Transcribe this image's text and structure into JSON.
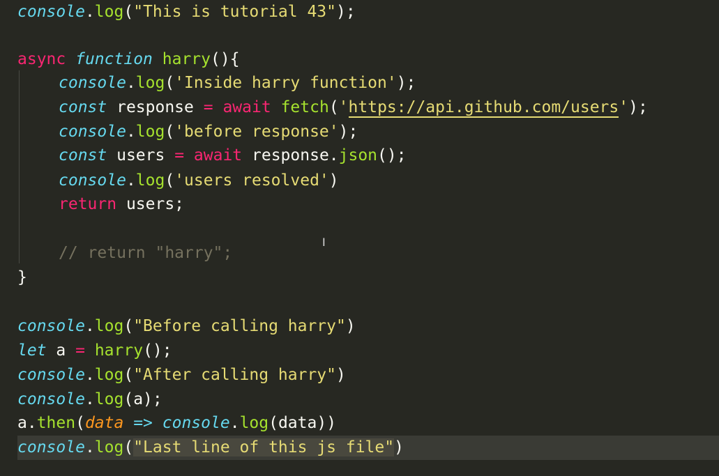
{
  "code": {
    "l1": {
      "obj": "console",
      "dot": ".",
      "fn": "log",
      "open": "(",
      "str": "\"This is tutorial 43\"",
      "close": ");"
    },
    "l3": {
      "kw": "async",
      "sp": " ",
      "kw2": "function",
      "sp2": " ",
      "name": "harry",
      "rest": "(){"
    },
    "l4": {
      "obj": "console",
      "dot": ".",
      "fn": "log",
      "open": "(",
      "str": "'Inside harry function'",
      "close": ");"
    },
    "l5": {
      "kw": "const",
      "v": " response ",
      "op": "=",
      "sp": " ",
      "aw": "await",
      "sp2": " ",
      "fn": "fetch",
      "open": "(",
      "q1": "'",
      "url": "https://api.github.com/users",
      "q2": "'",
      "close": ");"
    },
    "l6": {
      "obj": "console",
      "dot": ".",
      "fn": "log",
      "open": "(",
      "str": "'before response'",
      "close": ");"
    },
    "l7": {
      "kw": "const",
      "v": " users ",
      "op": "=",
      "sp": " ",
      "aw": "await",
      "sp2": " ",
      "obj": "response.",
      "fn": "json",
      "close": "();"
    },
    "l8": {
      "obj": "console",
      "dot": ".",
      "fn": "log",
      "open": "(",
      "str": "'users resolved'",
      "close": ")"
    },
    "l9": {
      "kw": "return",
      "rest": " users;"
    },
    "l11": {
      "comment": "// return \"harry\";"
    },
    "l12": {
      "text": "}"
    },
    "l14": {
      "obj": "console",
      "dot": ".",
      "fn": "log",
      "open": "(",
      "str": "\"Before calling harry\"",
      "close": ")"
    },
    "l15": {
      "kw": "let",
      "v": " a ",
      "op": "=",
      "sp": " ",
      "fn": "harry",
      "close": "();"
    },
    "l16": {
      "obj": "console",
      "dot": ".",
      "fn": "log",
      "open": "(",
      "str": "\"After calling harry\"",
      "close": ")"
    },
    "l17": {
      "obj": "console",
      "dot": ".",
      "fn": "log",
      "rest": "(a);"
    },
    "l18": {
      "pre": "a.",
      "fn": "then",
      "open": "(",
      "param": "data",
      "sp": " ",
      "arrow": "=>",
      "sp2": " ",
      "obj": "console",
      "dot": ".",
      "fn2": "log",
      "rest": "(data))"
    },
    "l19": {
      "obj": "console",
      "dot": ".",
      "fn": "log",
      "open": "(",
      "str": "\"Last line of this js file\"",
      "close": ")"
    }
  },
  "colors": {
    "background": "#272822",
    "keyword": "#f92672",
    "storage": "#66d9ef",
    "function": "#a6e22e",
    "string": "#e6db74",
    "parameter": "#fd971f",
    "comment": "#75715e"
  },
  "mouse_cursor_icon": "text-cursor-icon"
}
